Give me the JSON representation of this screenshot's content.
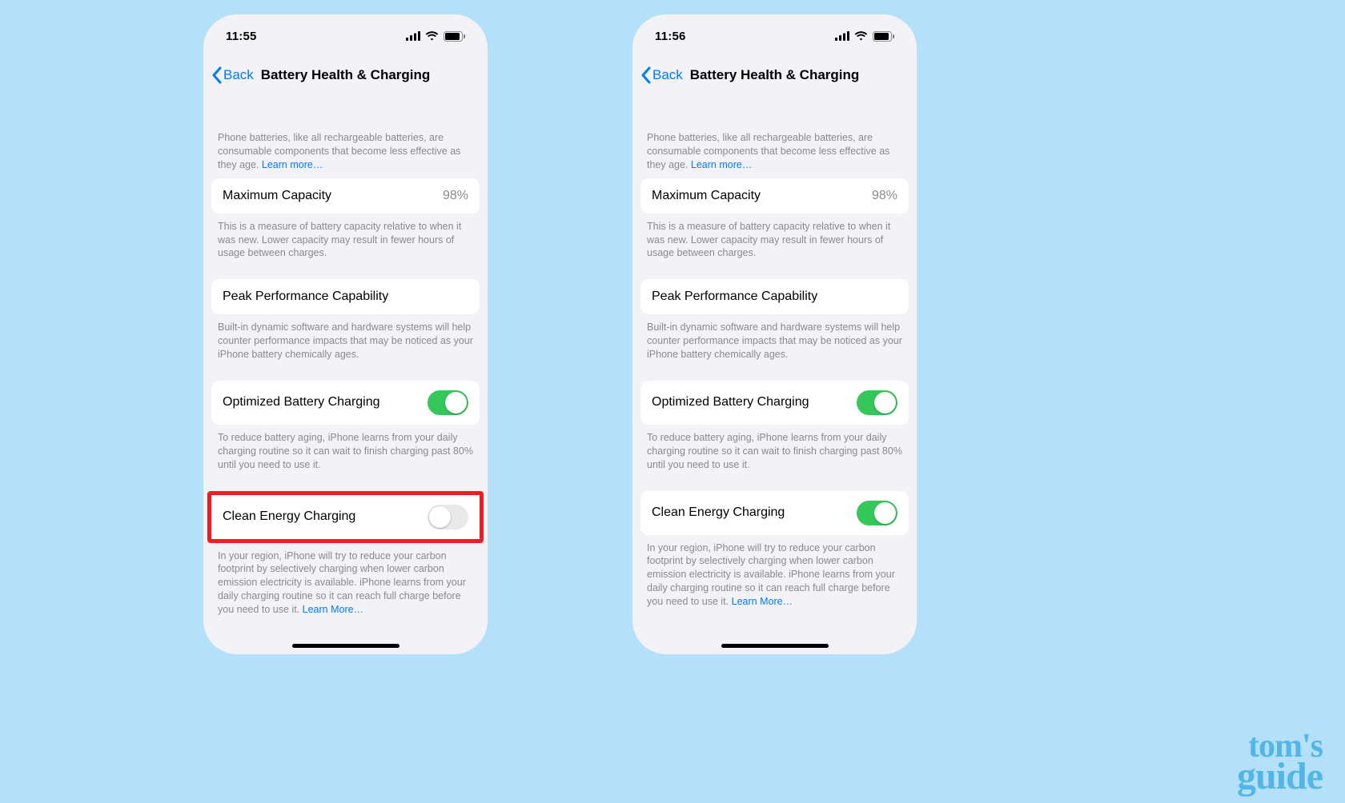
{
  "phones": [
    {
      "time": "11:55",
      "clean_energy_on": false,
      "highlight_clean_energy": true
    },
    {
      "time": "11:56",
      "clean_energy_on": true,
      "highlight_clean_energy": false
    }
  ],
  "nav": {
    "back": "Back",
    "title": "Battery Health & Charging"
  },
  "intro": {
    "text": "Phone batteries, like all rechargeable batteries, are consumable components that become less effective as they age. ",
    "link": "Learn more…"
  },
  "capacity": {
    "label": "Maximum Capacity",
    "value": "98%",
    "footer": "This is a measure of battery capacity relative to when it was new. Lower capacity may result in fewer hours of usage between charges."
  },
  "peak": {
    "label": "Peak Performance Capability",
    "footer": "Built-in dynamic software and hardware systems will help counter performance impacts that may be noticed as your iPhone battery chemically ages."
  },
  "optimized": {
    "label": "Optimized Battery Charging",
    "on": true,
    "footer": "To reduce battery aging, iPhone learns from your daily charging routine so it can wait to finish charging past 80% until you need to use it."
  },
  "clean_energy": {
    "label": "Clean Energy Charging",
    "footer_text": "In your region, iPhone will try to reduce your carbon footprint by selectively charging when lower carbon emission electricity is available. iPhone learns from your daily charging routine so it can reach full charge before you need to use it. ",
    "footer_link": "Learn More…"
  },
  "logo": {
    "line1": "tom's",
    "line2": "guide"
  }
}
